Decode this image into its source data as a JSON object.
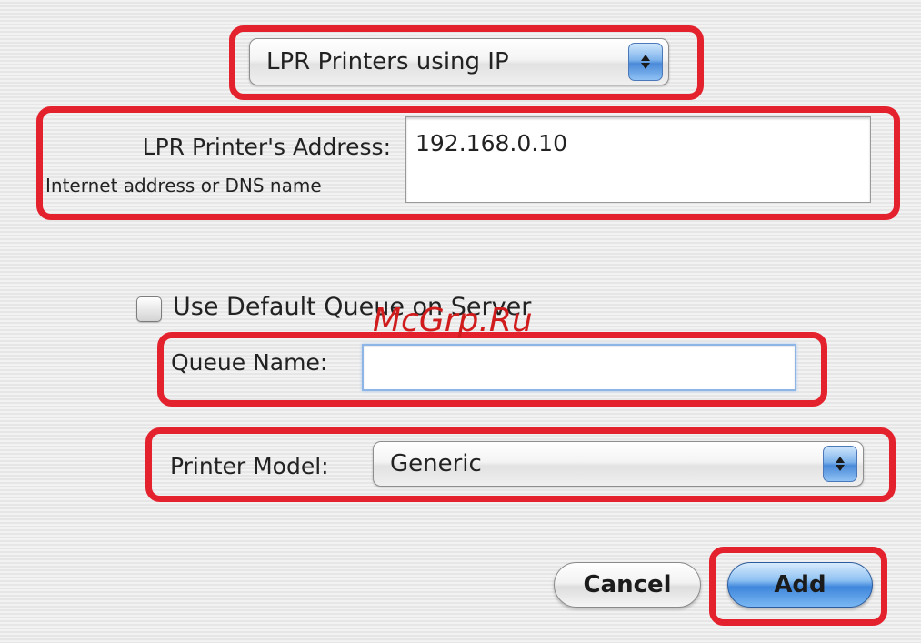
{
  "printer_type_popup": {
    "value": "LPR Printers using IP"
  },
  "address": {
    "label": "LPR Printer's Address:",
    "hint": "Internet address or DNS name",
    "value": "192.168.0.10"
  },
  "default_queue": {
    "label": "Use Default Queue on Server",
    "checked": false
  },
  "queue_name": {
    "label": "Queue Name:",
    "value": ""
  },
  "printer_model": {
    "label": "Printer Model:",
    "value": "Generic"
  },
  "buttons": {
    "cancel": "Cancel",
    "add": "Add"
  },
  "watermark": "McGrp.Ru",
  "colors": {
    "highlight": "#e4222d",
    "default_button": "#3f86db",
    "watermark": "#d01c1c"
  }
}
